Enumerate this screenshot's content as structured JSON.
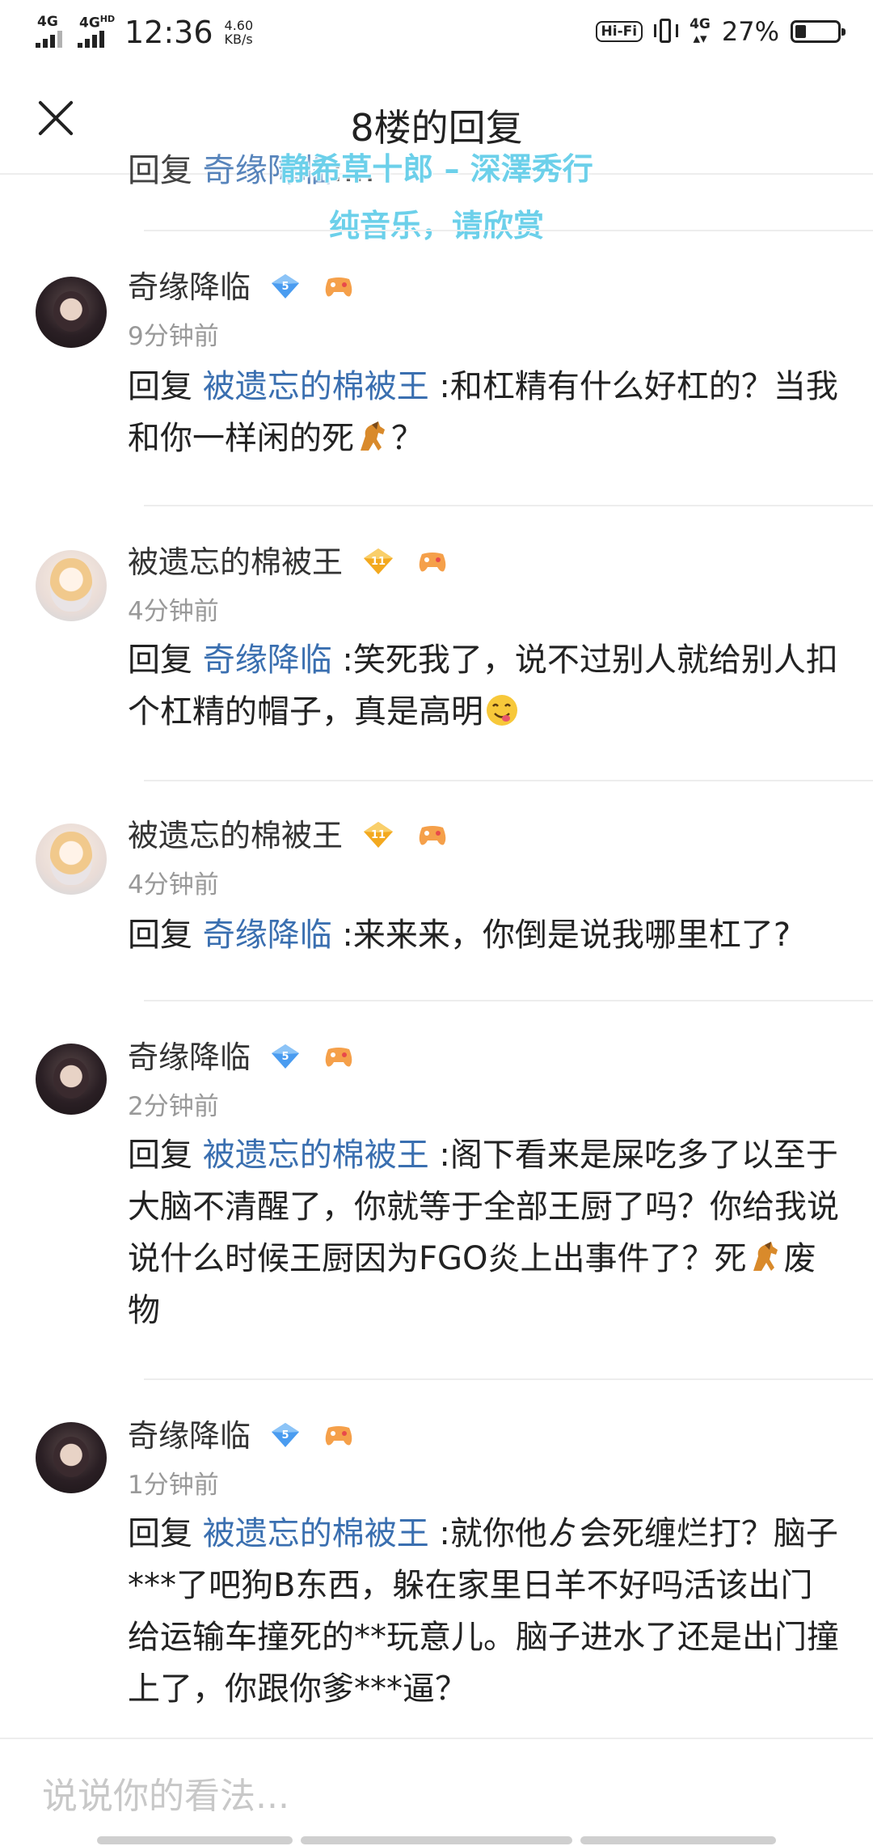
{
  "status_bar": {
    "sim1": "4G",
    "sim2": "4G",
    "sim2_sup": "HD",
    "time": "12:36",
    "speed_value": "4.60",
    "speed_unit": "KB/s",
    "hifi": "Hi-Fi",
    "net": "4G",
    "battery_pct": "27%",
    "battery_level": 0.27
  },
  "header": {
    "title": "8楼的回复"
  },
  "overlay": {
    "peek_prefix": "回复",
    "peek_name": "奇缘降临",
    "peek_tail": ":…",
    "music_line1": "静希草十郎 – 深澤秀行",
    "music_line2": "纯音乐，请欣赏"
  },
  "comments": [
    {
      "author": "奇缘降临",
      "level": "5",
      "time": "9分钟前",
      "reply_kw": "回复",
      "mention": "被遗忘的棉被王",
      "text_a": " :和杠精有什么好杠的？当我和你一样闲的死",
      "text_b": "？"
    },
    {
      "author": "被遗忘的棉被王",
      "level": "11",
      "time": "4分钟前",
      "reply_kw": "回复",
      "mention": "奇缘降临",
      "text_a": " :笑死我了，说不过别人就给别人扣个杠精的帽子，真是高明",
      "text_b": ""
    },
    {
      "author": "被遗忘的棉被王",
      "level": "11",
      "time": "4分钟前",
      "reply_kw": "回复",
      "mention": "奇缘降临",
      "text_a": " :来来来，你倒是说我哪里杠了?",
      "text_b": ""
    },
    {
      "author": "奇缘降临",
      "level": "5",
      "time": "2分钟前",
      "reply_kw": "回复",
      "mention": "被遗忘的棉被王",
      "text_a": " :阁下看来是屎吃多了以至于大脑不清醒了，你就等于全部王厨了吗？你给我说说什么时候王厨因为FGO炎上出事件了？死",
      "text_b": "废 物"
    },
    {
      "author": "奇缘降临",
      "level": "5",
      "time": "1分钟前",
      "reply_kw": "回复",
      "mention": "被遗忘的棉被王",
      "text_a": " :就你他ゟ会死缠烂打？脑子***了吧狗B东西，躲在家里日羊不好吗活该出门给运输车撞死的**玩意儿。脑子进水了还是出门撞上了，你跟你爹***逼？",
      "text_b": ""
    }
  ],
  "input": {
    "placeholder": "说说你的看法..."
  },
  "colors": {
    "mention": "#3a6fb0",
    "music_overlay": "#6cd0ea",
    "timestamp": "#999999"
  }
}
